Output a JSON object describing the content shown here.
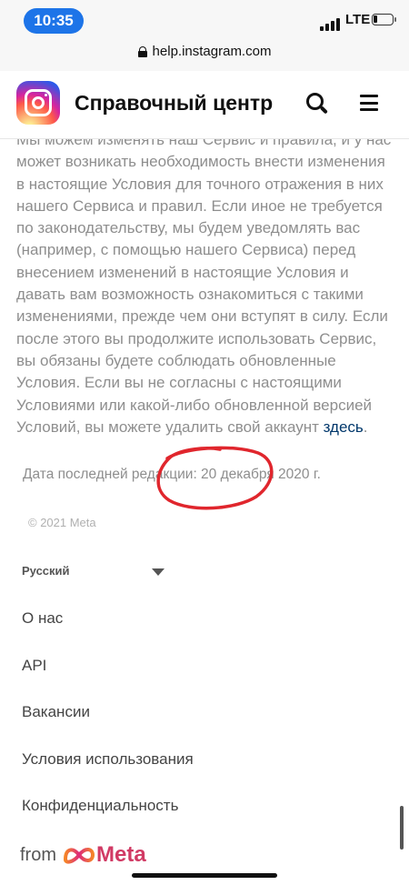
{
  "status_bar": {
    "time": "10:35",
    "network": "LTE"
  },
  "browser": {
    "url": "help.instagram.com"
  },
  "header": {
    "title": "Справочный центр",
    "logo_icon": "instagram-logo",
    "search_icon": "search-icon",
    "menu_icon": "hamburger-menu-icon"
  },
  "content": {
    "paragraph": "Мы можем изменять наш Сервис и правила, и у нас может возникать необходимость внести изменения в настоящие Условия для точного отражения в них нашего Сервиса и правил. Если иное не требуется по законодательству, мы будем уведомлять вас (например, с помощью нашего Сервиса) перед внесением изменений в настоящие Условия и давать вам возможность ознакомиться с такими изменениями, прежде чем они вступят в силу. Если после этого вы продолжите использовать Сервис, вы обязаны будете соблюдать обновленные Условия. Если вы не согласны с настоящими Условиями или какой-либо обновленной версией Условий, вы можете удалить свой аккаунт",
    "link_text": "здесь",
    "period": ".",
    "last_edited": "Дата последней редакции: 20 декабря 2020 г."
  },
  "footer": {
    "copyright": "© 2021 Meta",
    "language": "Русский",
    "links": [
      "О нас",
      "API",
      "Вакансии",
      "Условия использования",
      "Конфиденциальность"
    ],
    "from_label": "from",
    "brand": "Meta"
  },
  "colors": {
    "link": "#00376b",
    "annotation": "#e0262d",
    "meta_brand": "#d13a64",
    "time_pill": "#1d74e8"
  }
}
